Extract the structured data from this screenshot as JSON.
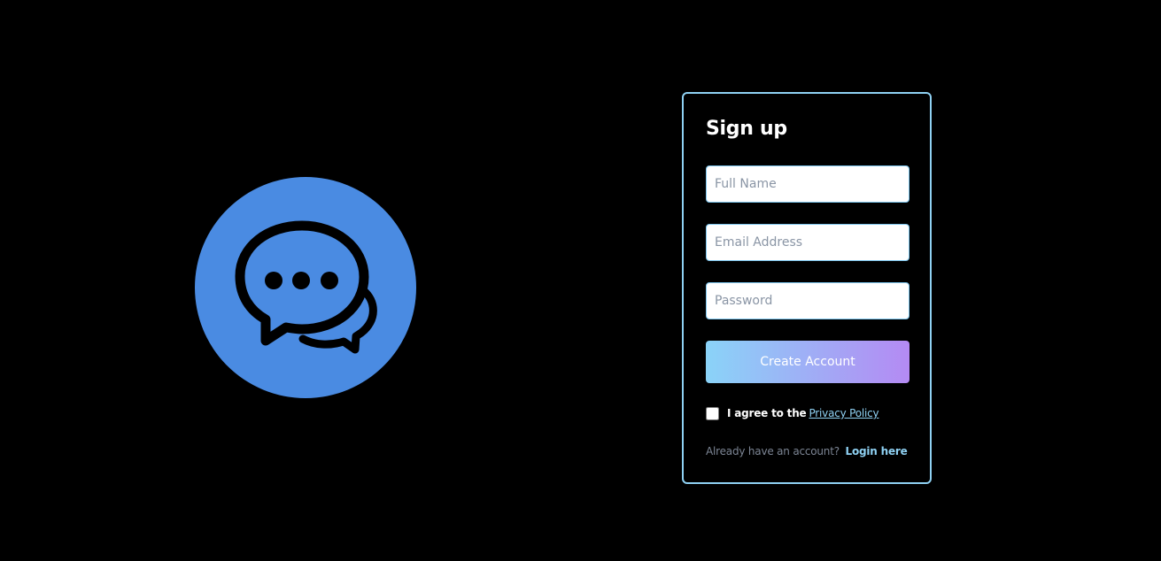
{
  "logo": {
    "icon": "chat-bubbles-icon",
    "circle_color": "#4a8be2",
    "glyph_color": "#000000"
  },
  "signup": {
    "title": "Sign up",
    "fields": {
      "full_name": {
        "placeholder": "Full Name",
        "value": ""
      },
      "email": {
        "placeholder": "Email Address",
        "value": ""
      },
      "password": {
        "placeholder": "Password",
        "value": ""
      }
    },
    "submit_label": "Create Account",
    "agree_checked": false,
    "agree_text": "I agree to the",
    "privacy_link": "Privacy Policy",
    "login_prompt": "Already have an account?",
    "login_link": "Login here"
  },
  "colors": {
    "background": "#000000",
    "card_border": "#8fd1f3",
    "button_gradient_start": "#8ad3f8",
    "button_gradient_end": "#b48af3",
    "link": "#8fd1f3"
  }
}
